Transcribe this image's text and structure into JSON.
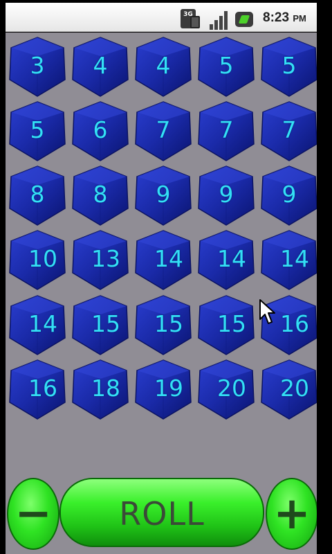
{
  "status_bar": {
    "network_badge": "3G",
    "time": "8:23",
    "ampm": "PM",
    "icons": [
      "3g-data-icon",
      "signal-strength-icon",
      "battery-charging-icon"
    ]
  },
  "dice": [
    [
      "3",
      "4",
      "4",
      "5",
      "5"
    ],
    [
      "5",
      "6",
      "7",
      "7",
      "7"
    ],
    [
      "8",
      "8",
      "9",
      "9",
      "9"
    ],
    [
      "10",
      "13",
      "14",
      "14",
      "14"
    ],
    [
      "14",
      "15",
      "15",
      "15",
      "16"
    ],
    [
      "16",
      "18",
      "19",
      "20",
      "20"
    ]
  ],
  "controls": {
    "minus": "−",
    "roll": "ROLL",
    "plus": "+"
  },
  "colors": {
    "background": "#908d95",
    "die_face": "#1a2aa8",
    "die_text": "#33e0f5",
    "button_green": "#2fe323"
  }
}
